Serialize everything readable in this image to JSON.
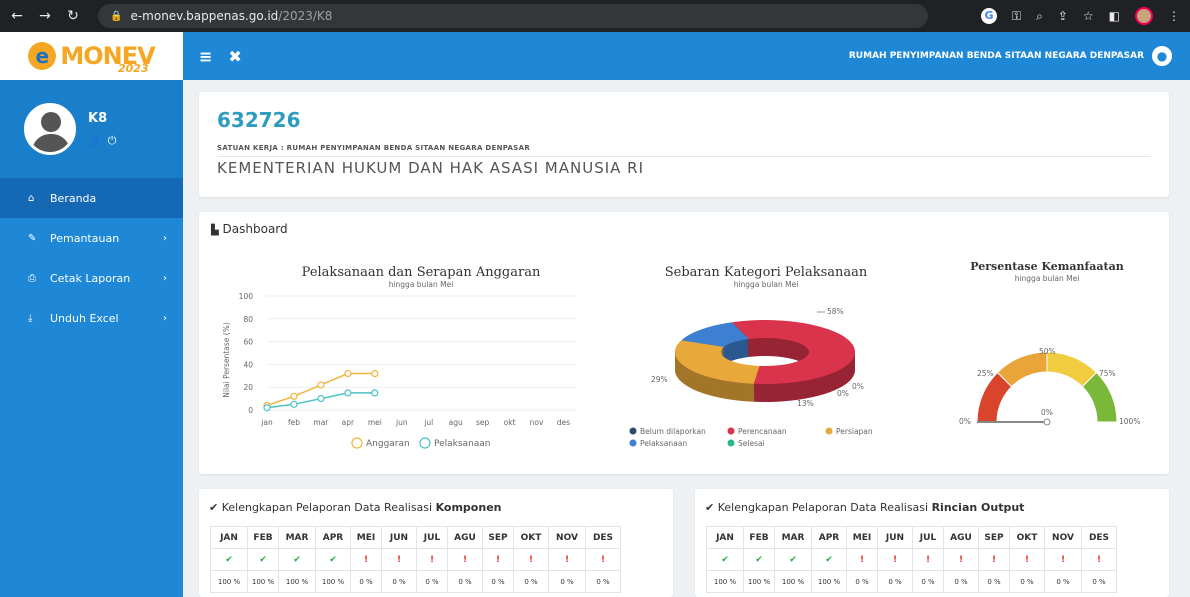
{
  "browser": {
    "host": "e-monev.bappenas.go.id",
    "path": "/2023/K8"
  },
  "sidebar": {
    "logo": "MONEV",
    "logo_year": "2023",
    "username": "K8",
    "items": [
      {
        "label": "Beranda",
        "icon": "home-icon",
        "active": true
      },
      {
        "label": "Pemantauan",
        "icon": "pencil-icon"
      },
      {
        "label": "Cetak Laporan",
        "icon": "print-icon"
      },
      {
        "label": "Unduh Excel",
        "icon": "download-icon"
      }
    ]
  },
  "topbar": {
    "org_name": "RUMAH PENYIMPANAN BENDA SITAAN NEGARA DENPASAR"
  },
  "info": {
    "kode": "632726",
    "satker": "SATUAN KERJA : RUMAH PENYIMPANAN BENDA SITAAN NEGARA DENPASAR",
    "kementerian": "KEMENTERIAN HUKUM DAN HAK ASASI MANUSIA RI"
  },
  "dashboard": {
    "title": "Dashboard"
  },
  "chart_data": [
    {
      "type": "line",
      "title": "Pelaksanaan dan Serapan Anggaran",
      "subtitle": "hingga bulan Mei",
      "ylabel": "Nilai Persentase (%)",
      "ylim": [
        0,
        100
      ],
      "yticks": [
        0,
        20,
        40,
        60,
        80,
        100
      ],
      "categories": [
        "jan",
        "feb",
        "mar",
        "apr",
        "mei",
        "jun",
        "jul",
        "agu",
        "sep",
        "okt",
        "nov",
        "des"
      ],
      "series": [
        {
          "name": "Anggaran",
          "color": "#f0b43c",
          "values": [
            4,
            12,
            22,
            32,
            32
          ]
        },
        {
          "name": "Pelaksanaan",
          "color": "#4cc3c6",
          "values": [
            2,
            5,
            10,
            15,
            15
          ]
        }
      ]
    },
    {
      "type": "pie",
      "title": "Sebaran Kategori Pelaksanaan",
      "subtitle": "hingga bulan Mei",
      "slices": [
        {
          "name": "Belum dilaporkan",
          "value": 0,
          "color": "#2e4a6b"
        },
        {
          "name": "Perencanaan",
          "value": 58,
          "color": "#d9344c"
        },
        {
          "name": "Persiapan",
          "value": 29,
          "color": "#e8a83a"
        },
        {
          "name": "Pelaksanaan",
          "value": 13,
          "color": "#3d7fd0"
        },
        {
          "name": "Selesai",
          "value": 0,
          "color": "#2fb58a"
        }
      ],
      "labels": [
        "58%",
        "29%",
        "13%",
        "0%",
        "0%"
      ]
    },
    {
      "type": "gauge",
      "title": "Persentase Kemanfaatan",
      "subtitle": "hingga bulan Mei",
      "value": 0,
      "ticks": [
        "0%",
        "25%",
        "50%",
        "75%",
        "100%"
      ],
      "value_label": "0%"
    }
  ],
  "komponen": {
    "title_prefix": "Kelengkapan Pelaporan Data Realisasi ",
    "title_bold": "Komponen"
  },
  "rincian": {
    "title_prefix": "Kelengkapan Pelaporan Data Realisasi ",
    "title_bold": "Rincian Output"
  },
  "months": [
    "JAN",
    "FEB",
    "MAR",
    "APR",
    "MEI",
    "JUN",
    "JUL",
    "AGU",
    "SEP",
    "OKT",
    "NOV",
    "DES"
  ],
  "status": [
    "ok",
    "ok",
    "ok",
    "ok",
    "no",
    "no",
    "no",
    "no",
    "no",
    "no",
    "no",
    "no"
  ],
  "pct": [
    "100 %",
    "100 %",
    "100 %",
    "100 %",
    "0 %",
    "0 %",
    "0 %",
    "0 %",
    "0 %",
    "0 %",
    "0 %",
    "0 %"
  ]
}
